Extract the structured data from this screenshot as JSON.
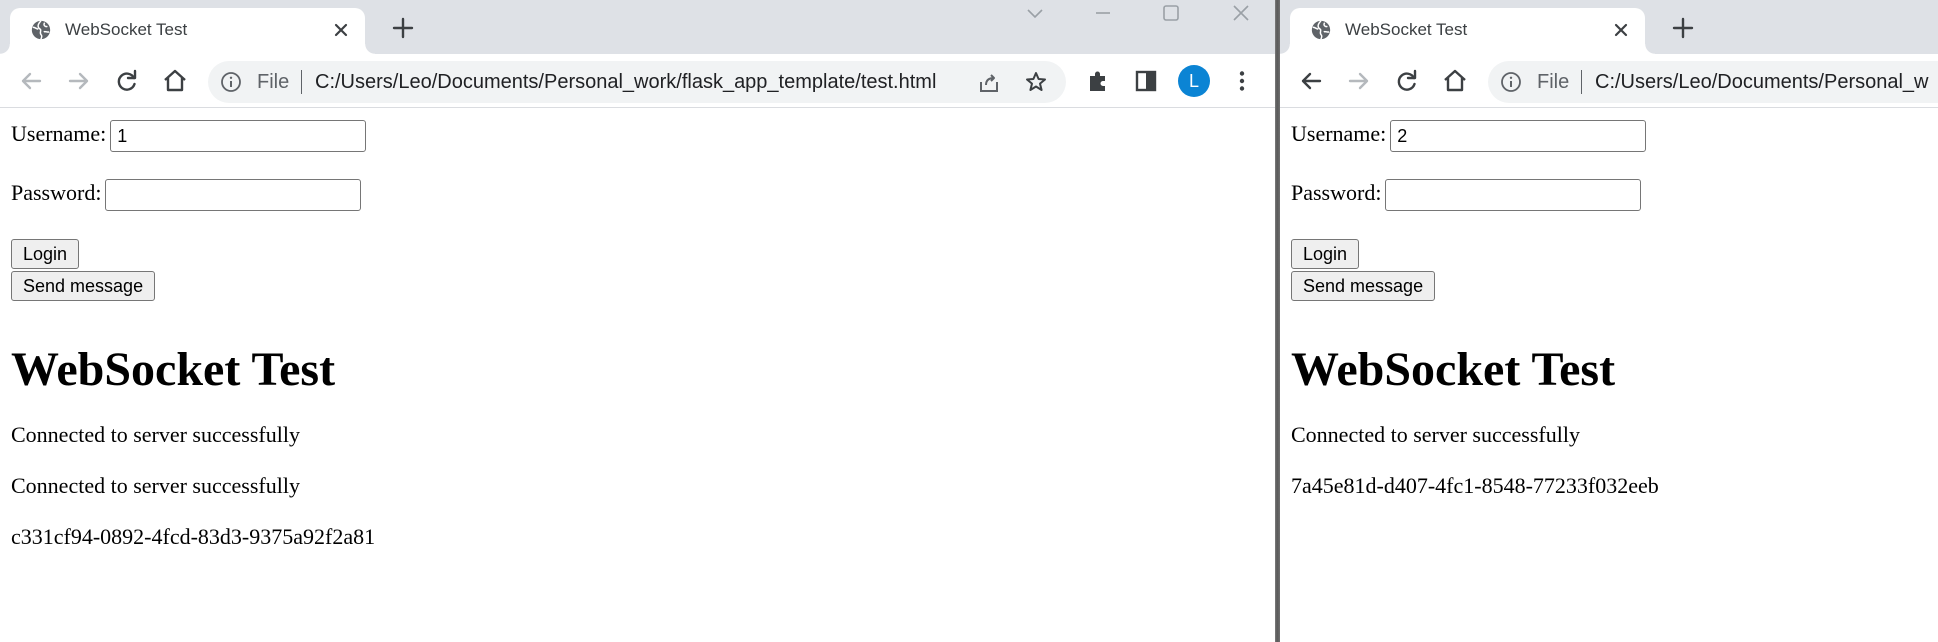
{
  "left_window": {
    "tab": {
      "title": "WebSocket Test"
    },
    "address_bar": {
      "scheme_label": "File",
      "url": "C:/Users/Leo/Documents/Personal_work/flask_app_template/test.html"
    },
    "profile_initial": "L",
    "page": {
      "username_label": "Username:",
      "username_value": "1",
      "password_label": "Password:",
      "password_value": "",
      "login_button": "Login",
      "send_button": "Send message",
      "heading": "WebSocket Test",
      "messages": [
        "Connected to server successfully",
        "Connected to server successfully",
        "c331cf94-0892-4fcd-83d3-9375a92f2a81"
      ]
    }
  },
  "right_window": {
    "tab": {
      "title": "WebSocket Test"
    },
    "address_bar": {
      "scheme_label": "File",
      "url": "C:/Users/Leo/Documents/Personal_w"
    },
    "page": {
      "username_label": "Username:",
      "username_value": "2",
      "password_label": "Password:",
      "password_value": "",
      "login_button": "Login",
      "send_button": "Send message",
      "heading": "WebSocket Test",
      "messages": [
        "Connected to server successfully",
        "7a45e81d-d407-4fc1-8548-77233f032eeb"
      ]
    }
  },
  "icons": {
    "favicon": "globe-icon",
    "tab_close": "close-icon",
    "new_tab": "plus-icon",
    "back": "arrow-left-icon",
    "forward": "arrow-right-icon",
    "reload": "reload-icon",
    "home": "home-icon",
    "site_info": "info-icon",
    "share": "share-icon",
    "bookmark": "star-icon",
    "extensions": "puzzle-icon",
    "side_panel": "side-panel-icon",
    "menu": "kebab-menu-icon"
  },
  "colors": {
    "tabstrip": "#dee1e6",
    "omnibox": "#f1f3f4",
    "avatar": "#0b84d4",
    "divider": "#6b6b6b"
  }
}
